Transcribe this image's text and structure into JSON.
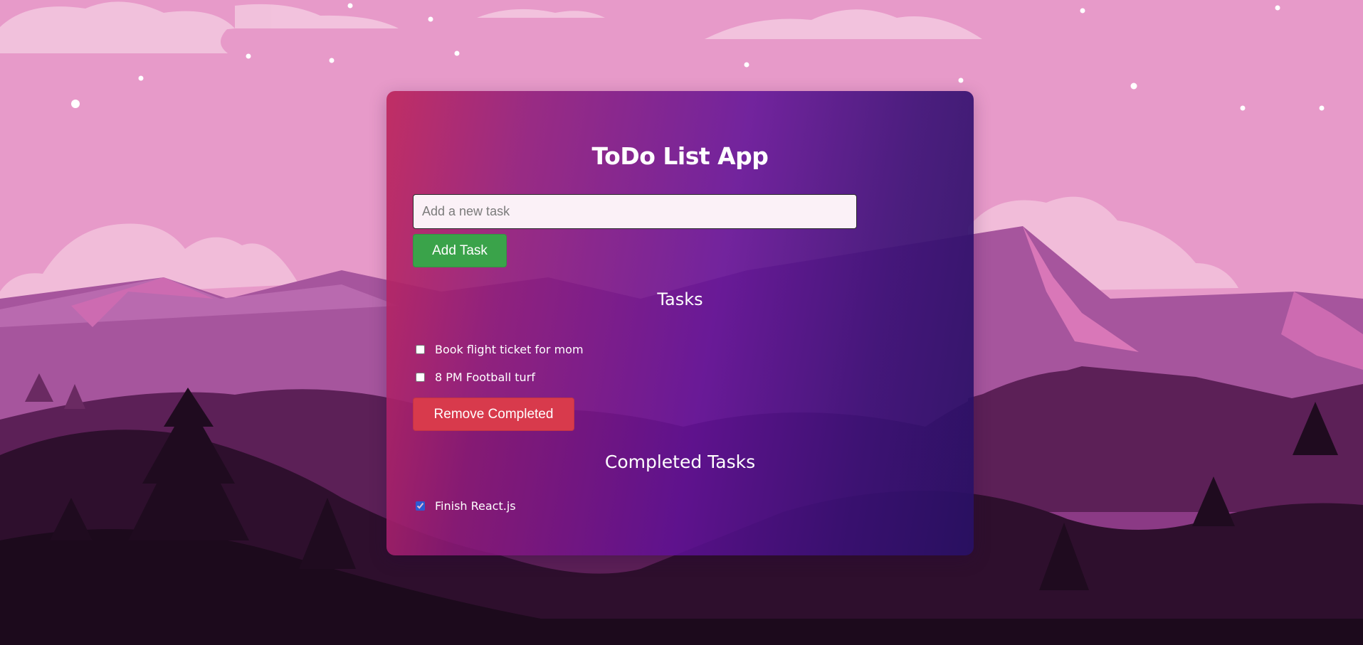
{
  "app": {
    "title": "ToDo List App"
  },
  "input": {
    "placeholder": "Add a new task",
    "value": ""
  },
  "buttons": {
    "add_label": "Add Task",
    "remove_label": "Remove Completed"
  },
  "tasks": {
    "heading": "Tasks",
    "items": [
      {
        "text": "Book flight ticket for mom",
        "checked": false
      },
      {
        "text": "8 PM Football turf",
        "checked": false
      }
    ]
  },
  "completed": {
    "heading": "Completed Tasks",
    "items": [
      {
        "text": "Finish React.js",
        "checked": true
      }
    ]
  },
  "colors": {
    "add_button": "#3aa34a",
    "remove_button": "#d83a4c",
    "sky": "#e79ac9",
    "card_gradient_start": "#be285f",
    "card_gradient_end": "#281064"
  }
}
